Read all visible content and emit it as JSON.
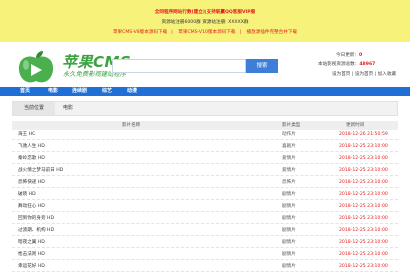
{
  "banner": {
    "line1": "全同程序网站行数(建立)|支持联赢QQ客服VIP服",
    "line2": "资源站注册6000群 资源站注册: XXXXX群",
    "links": [
      "苹果CMS-V8版本源码下载",
      "苹果CMS-V10版本源码下载",
      "播放源插件完整合并下载"
    ]
  },
  "header": {
    "logo_text": "苹果CMS",
    "logo_slogan": "永久免费影视建站程序",
    "search_placeholder": "",
    "search_button": "搜索",
    "today_label": "今日更新：",
    "today_value": "0",
    "total_label": "本站影视资源总数：",
    "total_value": "48967",
    "links_text": "设为首页 | 设为首页 | 加入收藏"
  },
  "nav": [
    "首页",
    "电影",
    "连续剧",
    "综艺",
    "动漫"
  ],
  "breadcrumb": {
    "title": "当前位置",
    "category": "电影"
  },
  "table": {
    "headers": [
      "影片名称",
      "影片类型",
      "更新时间"
    ],
    "rows": [
      {
        "title": "海王 HC",
        "type": "动作片",
        "time": "2018-12-26 21:50:59"
      },
      {
        "title": "飞驰人生 HD",
        "type": "喜剧片",
        "time": "2018-12-25 23:10:00"
      },
      {
        "title": "秦岭恋歌 HD",
        "type": "爱情片",
        "time": "2018-12-25 23:10:00"
      },
      {
        "title": "战火情之梦马前日 HD",
        "type": "爱情片",
        "time": "2018-12-25 23:10:00"
      },
      {
        "title": "恐怖快递 HD",
        "type": "恐怖片",
        "time": "2018-12-25 23:10:00"
      },
      {
        "title": "破晓 HD",
        "type": "剧情片",
        "time": "2018-12-25 23:10:00"
      },
      {
        "title": "舞动狂心 HD",
        "type": "剧情片",
        "time": "2018-12-25 23:10:00"
      },
      {
        "title": "回到你的身旁 HD",
        "type": "剧情片",
        "time": "2018-12-25 23:10:00"
      },
      {
        "title": "过渡期、机构 HD",
        "type": "剧情片",
        "time": "2018-12-25 23:10:00"
      },
      {
        "title": "暗夜之翼 HD",
        "type": "剧情片",
        "time": "2018-12-25 23:10:00"
      },
      {
        "title": "枪击法则 HD",
        "type": "剧情片",
        "time": "2018-12-25 23:10:00"
      },
      {
        "title": "幸运花好 HD",
        "type": "剧情片",
        "time": "2018-12-25 23:10:00"
      }
    ]
  },
  "colors": {
    "banner_bg": "#f7f37a",
    "accent_red": "#e11d1d",
    "nav_blue": "#1f6fd6",
    "logo_green": "#3aa23f"
  }
}
